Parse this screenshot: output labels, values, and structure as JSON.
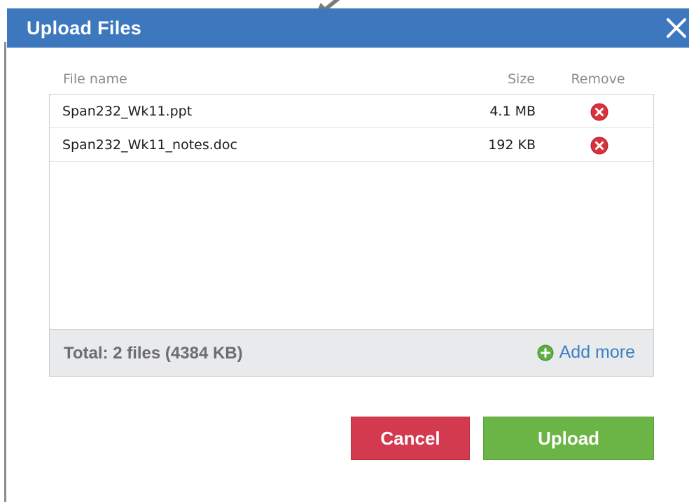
{
  "dialog": {
    "title": "Upload Files"
  },
  "table": {
    "headers": {
      "name": "File name",
      "size": "Size",
      "remove": "Remove"
    },
    "rows": [
      {
        "name": "Span232_Wk11.ppt",
        "size": "4.1 MB"
      },
      {
        "name": "Span232_Wk11_notes.doc",
        "size": "192 KB"
      }
    ]
  },
  "footer": {
    "total": "Total: 2 files (4384 KB)",
    "add_more": "Add more"
  },
  "buttons": {
    "cancel": "Cancel",
    "upload": "Upload"
  },
  "icons": {
    "close": "close-icon",
    "remove": "remove-circle-icon",
    "add": "plus-circle-icon"
  },
  "colors": {
    "titlebar": "#3d78bf",
    "cancel": "#d33a50",
    "upload": "#6ab545",
    "link": "#3c7fc4",
    "remove": "#d9323d"
  }
}
